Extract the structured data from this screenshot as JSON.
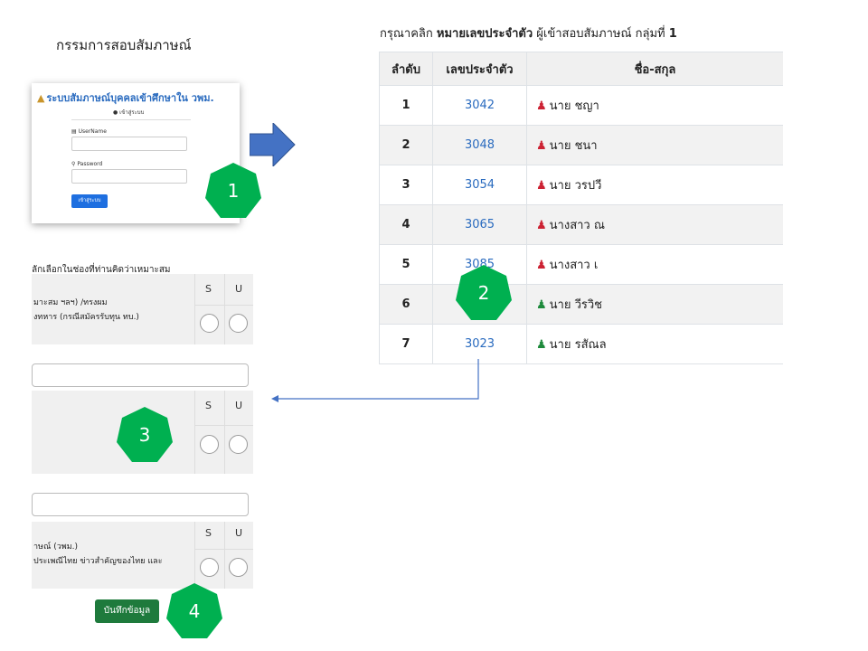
{
  "left_title": "กรรมการสอบสัมภาษณ์",
  "login": {
    "title": "ระบบสัมภาษณ์บุคคลเข้าศึกษาใน วพม.",
    "subtitle": "เข้าสู่ระบบ",
    "username_label": "UserName",
    "password_label": "Password",
    "login_button": "เข้าสู่ระบบ"
  },
  "badges": [
    "1",
    "2",
    "3",
    "4"
  ],
  "table": {
    "title_prefix": "กรุณาคลิก",
    "title_bold": "หมายเลขประจำตัว",
    "title_middle": "ผู้เข้าสอบสัมภาษณ์ กลุ่มที่",
    "title_group": "1",
    "headers": [
      "ลำดับ",
      "เลขประจำตัว",
      "ชื่อ-สกุล"
    ],
    "rows": [
      {
        "no": "1",
        "id": "3042",
        "name": "นาย ชญา",
        "icon_color": "#cc2233"
      },
      {
        "no": "2",
        "id": "3048",
        "name": "นาย ชนา",
        "icon_color": "#cc2233"
      },
      {
        "no": "3",
        "id": "3054",
        "name": "นาย วรปวี",
        "icon_color": "#cc2233"
      },
      {
        "no": "4",
        "id": "3065",
        "name": "นางสาว ณ",
        "icon_color": "#cc2233"
      },
      {
        "no": "5",
        "id": "3085",
        "name": "นางสาว เ",
        "icon_color": "#cc2233"
      },
      {
        "no": "6",
        "id": "",
        "name": "นาย วีรวิช",
        "icon_color": "#1e8a3c"
      },
      {
        "no": "7",
        "id": "3023",
        "name": "นาย รสัณล",
        "icon_color": "#1e8a3c"
      }
    ]
  },
  "form": {
    "header": "ลักเลือกในช่องที่ท่านคิดว่าเหมาะสม",
    "s_label": "S",
    "u_label": "U",
    "q1_line1": "มาะสม ฯลฯ) /ทรงผม",
    "q1_line2": "งทหาร (กรณีสมัครรับทุน ทบ.)",
    "q3_line1": "าษณ์ (วพม.)",
    "q3_line2": "ประเพณีไทย ข่าวสำคัญของไทย และ",
    "save_button": "บันทึกข้อมูล"
  },
  "colors": {
    "badge_green": "#00b050",
    "arrow_blue": "#4472c4",
    "link_blue": "#2a6bbf",
    "save_green": "#1e7a3c"
  }
}
